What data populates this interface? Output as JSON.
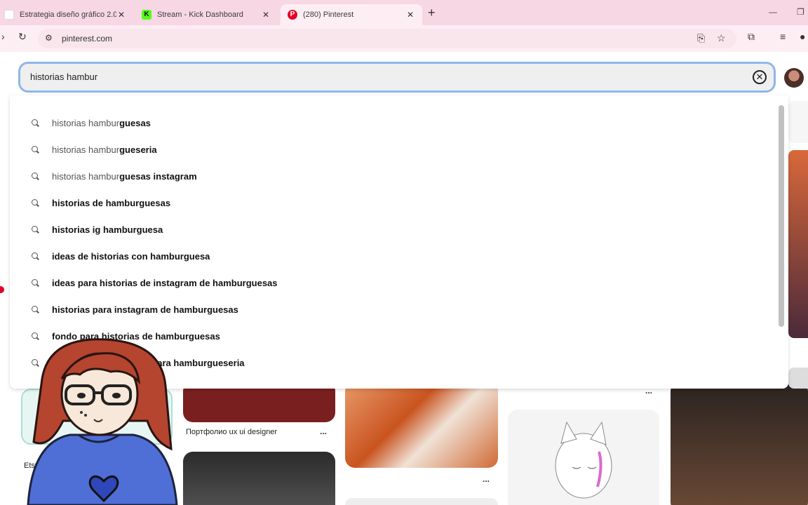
{
  "browser": {
    "tabs": [
      {
        "title": "Estrategia diseño gráfico 2.0",
        "active": false,
        "favicon_color": "#ffffff"
      },
      {
        "title": "Stream - Kick Dashboard",
        "active": false,
        "favicon_color": "#53fc18"
      },
      {
        "title": "(280) Pinterest",
        "active": true,
        "favicon_color": "#e60023"
      }
    ],
    "new_tab_icon": "plus-icon",
    "url": "pinterest.com"
  },
  "search": {
    "value": "historias hambur",
    "clear_icon": "close-circle-icon"
  },
  "suggestions": [
    {
      "prefix": "historias hambur",
      "rest": "guesas"
    },
    {
      "prefix": "historias hambur",
      "rest": "gueseria"
    },
    {
      "prefix": "historias hambur",
      "rest": "guesas instagram"
    },
    {
      "prefix": "",
      "rest": "historias de hamburguesas"
    },
    {
      "prefix": "",
      "rest": "historias ig hamburguesa"
    },
    {
      "prefix": "",
      "rest": "ideas de historias con hamburguesa"
    },
    {
      "prefix": "",
      "rest": "ideas para historias de instagram de hamburguesas"
    },
    {
      "prefix": "",
      "rest": "historias para instagram de hamburguesas"
    },
    {
      "prefix": "",
      "rest": "fondo para historias de hamburguesas"
    },
    {
      "prefix": "",
      "rest": "historias de instagram para hamburgueseria"
    }
  ],
  "pins": {
    "caption_portfolio": "Портфолио ux ui designer",
    "more": "...",
    "etsy": "Etsy"
  },
  "colors": {
    "tabstrip": "#f7d7e3",
    "focus_ring": "#8fb7e8",
    "pinterest_red": "#e60023"
  }
}
